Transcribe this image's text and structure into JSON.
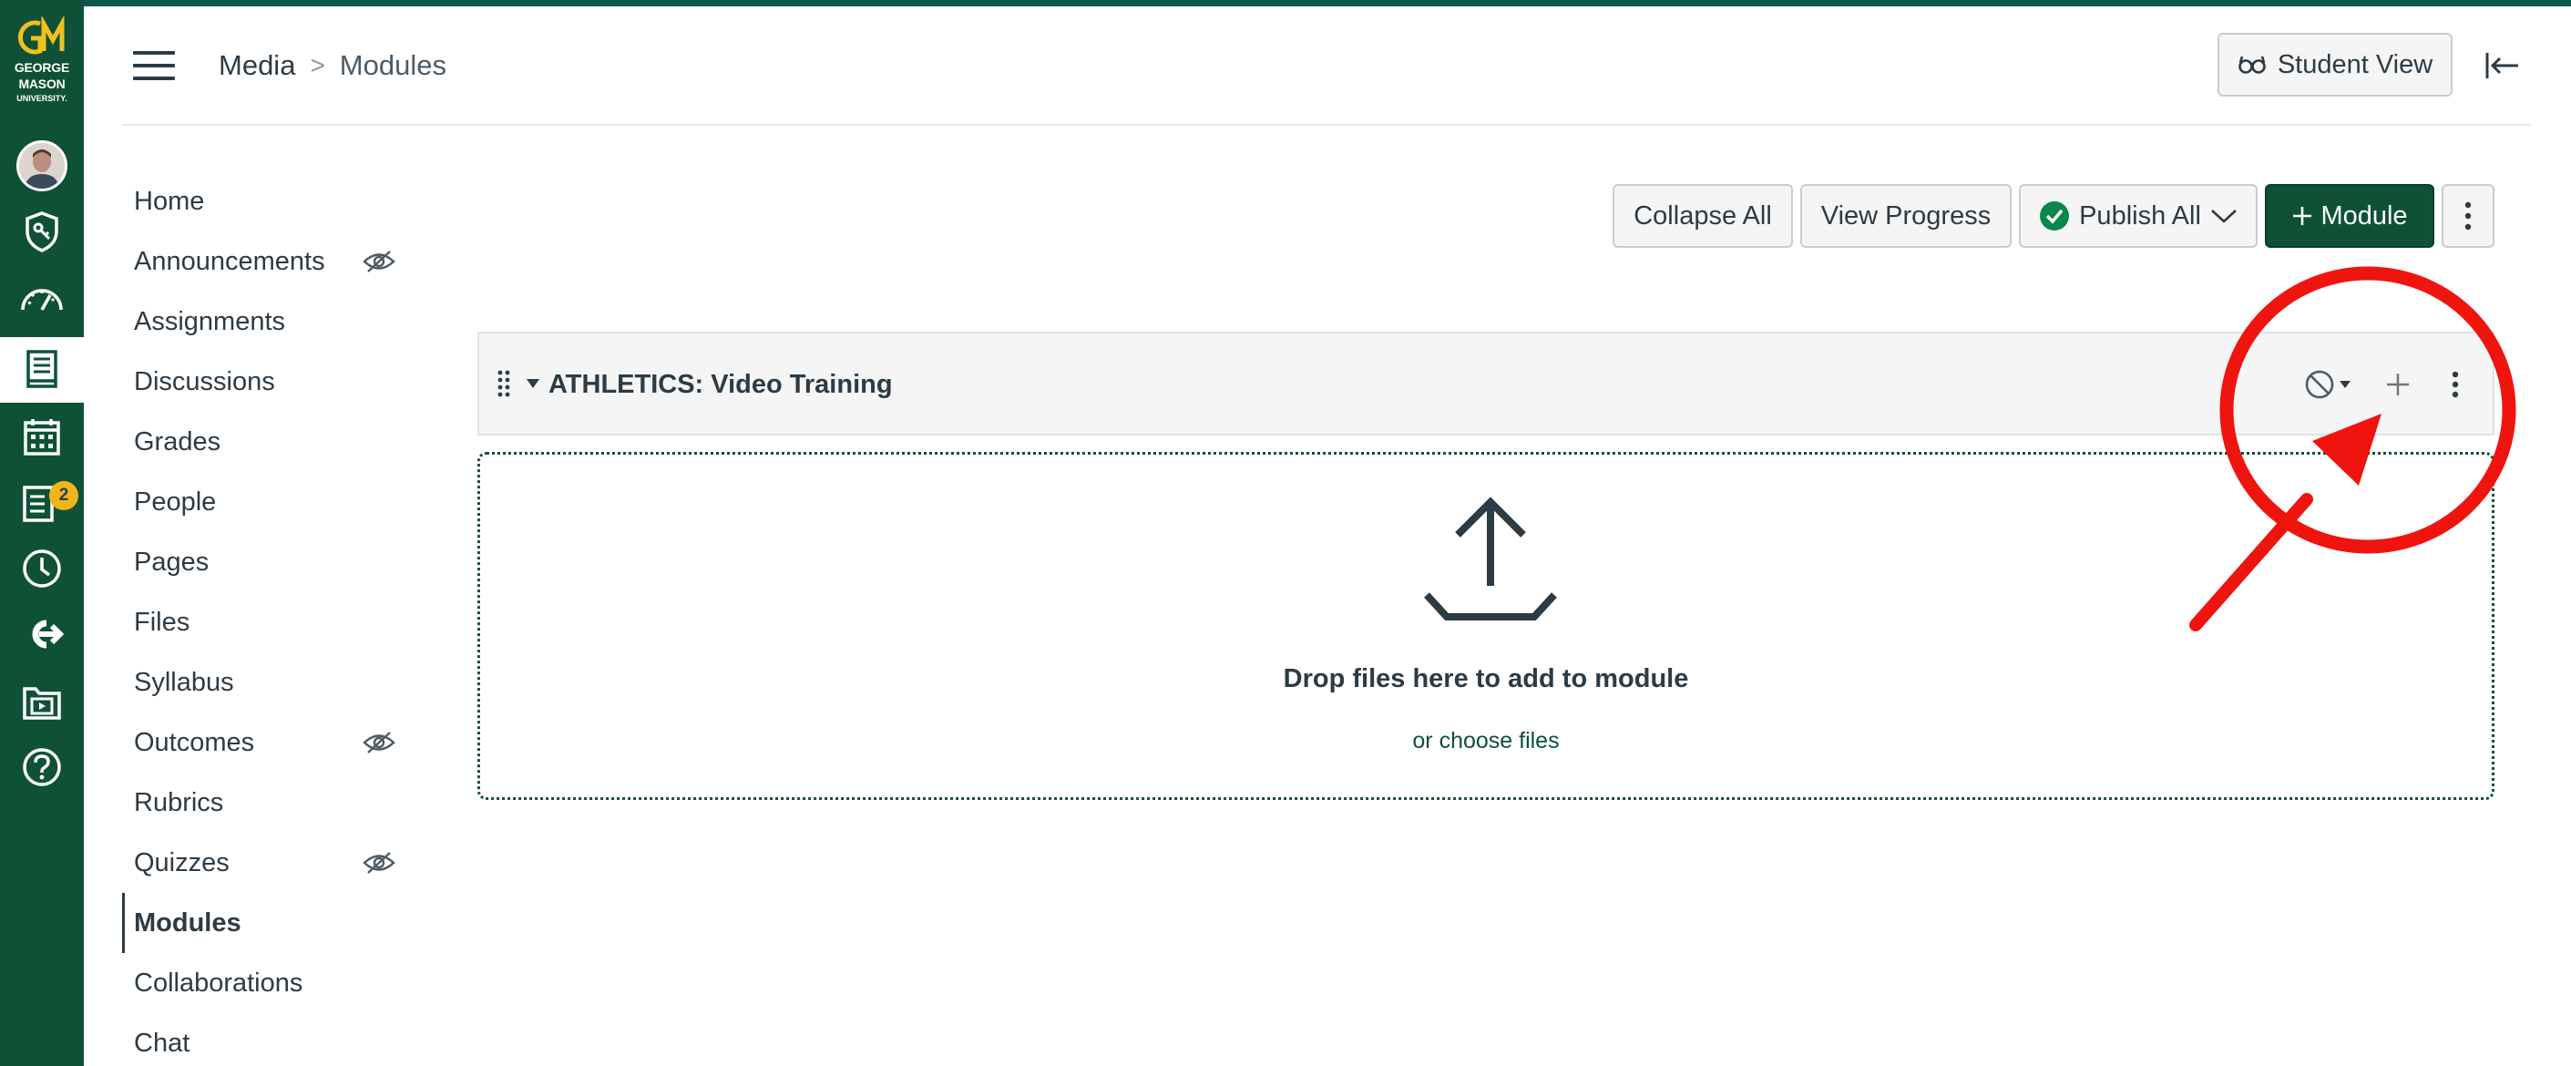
{
  "global_nav": {
    "logo": {
      "monogram": "GM",
      "line1": "GEORGE",
      "line2": "MASON",
      "line3": "UNIVERSITY."
    },
    "items": [
      {
        "name": "account",
        "icon": "avatar"
      },
      {
        "name": "admin",
        "icon": "shield-icon"
      },
      {
        "name": "dashboard",
        "icon": "dashboard-icon"
      },
      {
        "name": "courses",
        "icon": "book-icon",
        "active": true
      },
      {
        "name": "calendar",
        "icon": "calendar-icon"
      },
      {
        "name": "inbox",
        "icon": "inbox-icon",
        "badge": "2"
      },
      {
        "name": "history",
        "icon": "clock-icon"
      },
      {
        "name": "commons",
        "icon": "commons-icon"
      },
      {
        "name": "studio",
        "icon": "studio-icon"
      },
      {
        "name": "help",
        "icon": "help-icon"
      }
    ],
    "colors": {
      "background": "#0f5137",
      "badge": "#f2b41a"
    }
  },
  "header": {
    "breadcrumb": {
      "course": "Media",
      "separator": ">",
      "current": "Modules"
    },
    "student_view_label": "Student View"
  },
  "course_nav": {
    "items": [
      {
        "label": "Home"
      },
      {
        "label": "Announcements",
        "hidden_icon": true
      },
      {
        "label": "Assignments"
      },
      {
        "label": "Discussions"
      },
      {
        "label": "Grades"
      },
      {
        "label": "People"
      },
      {
        "label": "Pages"
      },
      {
        "label": "Files"
      },
      {
        "label": "Syllabus"
      },
      {
        "label": "Outcomes",
        "hidden_icon": true
      },
      {
        "label": "Rubrics"
      },
      {
        "label": "Quizzes",
        "hidden_icon": true
      },
      {
        "label": "Modules",
        "active": true
      },
      {
        "label": "Collaborations"
      },
      {
        "label": "Chat"
      }
    ]
  },
  "toolbar": {
    "collapse_all": "Collapse All",
    "view_progress": "View Progress",
    "publish_all": "Publish All",
    "add_module": "Module"
  },
  "module": {
    "title": "ATHLETICS: Video Training",
    "dropzone_main": "Drop files here to add to module",
    "dropzone_sub": "or choose files"
  },
  "colors": {
    "brand_green": "#0f5137",
    "publish_check": "#0b874b",
    "annotation_red": "#f0140f"
  }
}
